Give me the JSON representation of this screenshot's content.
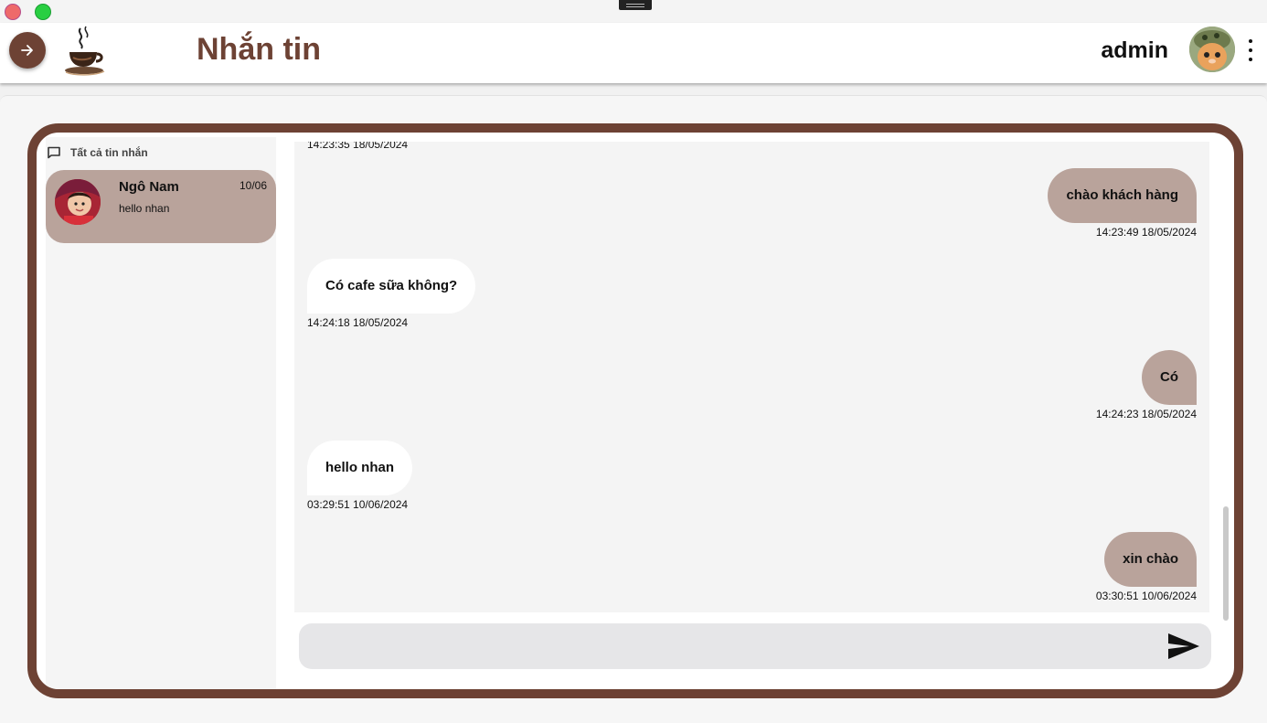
{
  "header": {
    "title": "Nhắn tin",
    "user_name": "admin"
  },
  "sidebar": {
    "section_label": "Tất cả tin nhắn",
    "conversations": [
      {
        "name": "Ngô Nam",
        "date": "10/06",
        "preview": "hello nhan"
      }
    ]
  },
  "messages": [
    {
      "side": "left",
      "text": "",
      "time": "14:23:35 18/05/2024"
    },
    {
      "side": "right",
      "text": "chào khách hàng",
      "time": "14:23:49 18/05/2024"
    },
    {
      "side": "left",
      "text": "Có cafe sữa không?",
      "time": "14:24:18 18/05/2024"
    },
    {
      "side": "right",
      "text": "Có",
      "time": "14:24:23 18/05/2024"
    },
    {
      "side": "left",
      "text": "hello nhan",
      "time": "03:29:51 10/06/2024"
    },
    {
      "side": "right",
      "text": "xin chào",
      "time": "03:30:51 10/06/2024"
    }
  ],
  "composer": {
    "value": "",
    "placeholder": ""
  },
  "icons": {
    "back": "arrow-right-icon",
    "logo": "coffee-cup-logo",
    "more": "more-vertical-icon",
    "section": "chat-bubble-icon",
    "send": "send-icon"
  },
  "colors": {
    "accent": "#6d4234",
    "bubble_outgoing": "#b9a39b",
    "bubble_incoming": "#ffffff"
  }
}
